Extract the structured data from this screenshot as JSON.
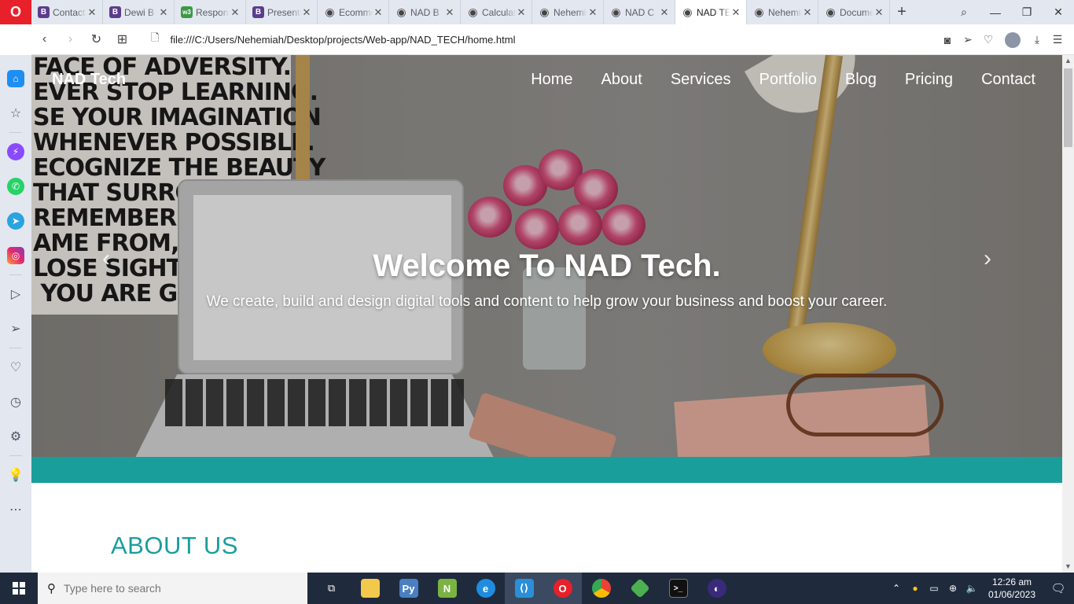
{
  "browser": {
    "tabs": [
      {
        "title": "Contact",
        "icon": "bootstrap-icon",
        "icon_text": "B",
        "kind": "b"
      },
      {
        "title": "Dewi B",
        "icon": "bootstrap-icon",
        "icon_text": "B",
        "kind": "b"
      },
      {
        "title": "Responsive",
        "icon": "w3schools-icon",
        "icon_text": "w3",
        "kind": "w3"
      },
      {
        "title": "Presentation",
        "icon": "bootstrap-icon",
        "icon_text": "B",
        "kind": "b"
      },
      {
        "title": "Ecommerce",
        "icon": "globe-icon",
        "icon_text": "◉",
        "kind": "globe"
      },
      {
        "title": "NAD B",
        "icon": "globe-icon",
        "icon_text": "◉",
        "kind": "globe"
      },
      {
        "title": "Calculator",
        "icon": "globe-icon",
        "icon_text": "◉",
        "kind": "globe"
      },
      {
        "title": "Nehemiah",
        "icon": "globe-icon",
        "icon_text": "◉",
        "kind": "globe"
      },
      {
        "title": "NAD C",
        "icon": "globe-icon",
        "icon_text": "◉",
        "kind": "globe"
      },
      {
        "title": "NAD TECH",
        "icon": "globe-icon",
        "icon_text": "◉",
        "kind": "globe",
        "active": true
      },
      {
        "title": "Nehemiah",
        "icon": "globe-icon",
        "icon_text": "◉",
        "kind": "globe"
      },
      {
        "title": "Document",
        "icon": "globe-icon",
        "icon_text": "◉",
        "kind": "globe"
      }
    ],
    "close_glyph": "✕",
    "new_tab_glyph": "+",
    "url": "file:///C:/Users/Nehemiah/Desktop/projects/Web-app/NAD_TECH/home.html"
  },
  "site": {
    "brand": "NAD Tech",
    "nav": [
      "Home",
      "About",
      "Services",
      "Portfolio",
      "Blog",
      "Pricing",
      "Contact"
    ],
    "hero_title": "Welcome To NAD Tech.",
    "hero_subtitle": "We create, build and design digital tools and content to help grow your business and boost your career.",
    "poster_text": "FACE OF ADVERSITY.\nEVER STOP LEARNING.\nSE YOUR IMAGINATION\nWHENEVER POSSIBLE.\nECOGNIZE THE BEAUTY\nTHAT SURROUNDS\nREMEMBER WHERE\nAME FROM, BUT\nLOSE SIGHT OF\n YOU ARE GO",
    "about_heading": "ABOUT US",
    "accent_color": "#1a9e9c"
  },
  "taskbar": {
    "search_placeholder": "Type here to search",
    "time": "12:26 am",
    "date": "01/06/2023"
  }
}
